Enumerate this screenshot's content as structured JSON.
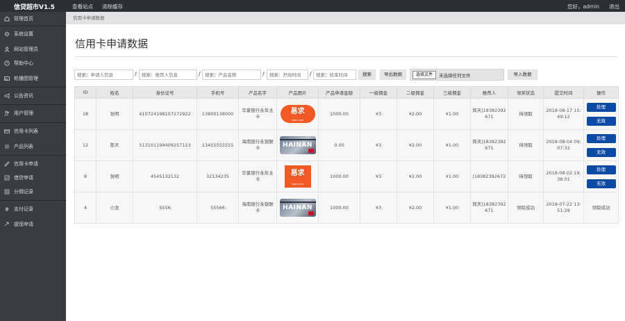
{
  "header": {
    "brand": "信贷超市V1.5",
    "links": [
      "查看站点",
      "清除缓存"
    ],
    "greeting": "您好，admin",
    "logout": "退出"
  },
  "sidebar": {
    "items": [
      {
        "label": "管理首页",
        "icon": "home-icon"
      },
      {
        "label": "系统设置",
        "icon": "gear-icon"
      },
      {
        "label": "网站管理员",
        "icon": "user-icon"
      },
      {
        "label": "帮助中心",
        "icon": "help-icon"
      },
      {
        "label": "轮播图管理",
        "icon": "image-icon"
      },
      {
        "label": "公告资讯",
        "icon": "bullhorn-icon"
      },
      {
        "label": "用户管理",
        "icon": "users-icon"
      },
      {
        "label": "信用卡列表",
        "icon": "card-icon"
      },
      {
        "label": "产品列表",
        "icon": "list-icon"
      },
      {
        "label": "信用卡申请",
        "icon": "card-apply-icon"
      },
      {
        "label": "借贷申请",
        "icon": "loan-icon"
      },
      {
        "label": "分佣记录",
        "icon": "commission-icon"
      },
      {
        "label": "支付记录",
        "icon": "payment-icon"
      },
      {
        "label": "提现申请",
        "icon": "withdraw-icon"
      }
    ]
  },
  "breadcrumb": "信用卡申请数据",
  "page_title": "信用卡申请数据",
  "filters": {
    "applicant_placeholder": "搜索：申请人信息",
    "referrer_placeholder": "搜索：推荐人信息",
    "product_placeholder": "搜索：产品名称",
    "start_placeholder": "搜索：开始时间",
    "end_placeholder": "搜索：结束时间",
    "search_label": "搜索",
    "export_label": "导出数据",
    "file_button": "选择文件",
    "file_status": "未选择任何文件",
    "import_label": "导入数据"
  },
  "table": {
    "columns": [
      "ID",
      "姓名",
      "身份证号",
      "手机号",
      "产品名字",
      "产品图片",
      "产品申请金额",
      "一级佣金",
      "二级佣金",
      "三级佣金",
      "推荐人",
      "领奖状态",
      "提交时间",
      "操作"
    ],
    "rows": [
      {
        "id": "18",
        "name": "张明",
        "idcard": "410724198107272922",
        "phone": "13800138000",
        "product": "华夏银行永年主卡",
        "image": "yiqiu-round",
        "amount": "1000.00",
        "c1": "¥3",
        "c2": "¥2.00",
        "c3": "¥1.00",
        "referrer": "阵天|18382392671",
        "status": "待领取",
        "time": "2018-08-17 15:49:12",
        "actions": [
          "处理",
          "无效"
        ]
      },
      {
        "id": "12",
        "name": "陈天",
        "idcard": "513101199409257123",
        "phone": "13455555555",
        "product": "海南银行永银联卡",
        "image": "hainan-card",
        "amount": "0.00",
        "c1": "¥3",
        "c2": "¥2.00",
        "c3": "¥1.00",
        "referrer": "阵天|18382392671",
        "status": "待领取",
        "time": "2018-08-04 09:07:32",
        "actions": [
          "处理",
          "无效"
        ]
      },
      {
        "id": "8",
        "name": "张明",
        "idcard": "4545132132",
        "phone": "32134235",
        "product": "华夏银行永年主卡",
        "image": "yiqiu-square",
        "amount": "1000.00",
        "c1": "¥3",
        "c2": "¥2.00",
        "c3": "¥1.00",
        "referrer": "|18382392672",
        "status": "待领取",
        "time": "2018-08-02 19:38:01",
        "actions": [
          "处理",
          "无效"
        ]
      },
      {
        "id": "4",
        "name": "小龙",
        "idcard": "5556",
        "phone": "55566",
        "product": "海南银行永银联卡",
        "image": "hainan-card",
        "amount": "1000.00",
        "c1": "¥3",
        "c2": "¥2.00",
        "c3": "¥1.00",
        "referrer": "阵天|18382392671",
        "status": "领取成功",
        "time": "2018-07-22 13:51:28",
        "op_text": "领取成功"
      }
    ]
  },
  "logos": {
    "yiqiu_text": "易求",
    "yiqiu_sub": "yiqiu.com",
    "hainan_text": "HAINAN"
  },
  "colors": {
    "topbar": "#2b2f33",
    "sidebar": "#393d42",
    "primary_button": "#0d4aa6",
    "logo_orange": "#f15a24"
  }
}
